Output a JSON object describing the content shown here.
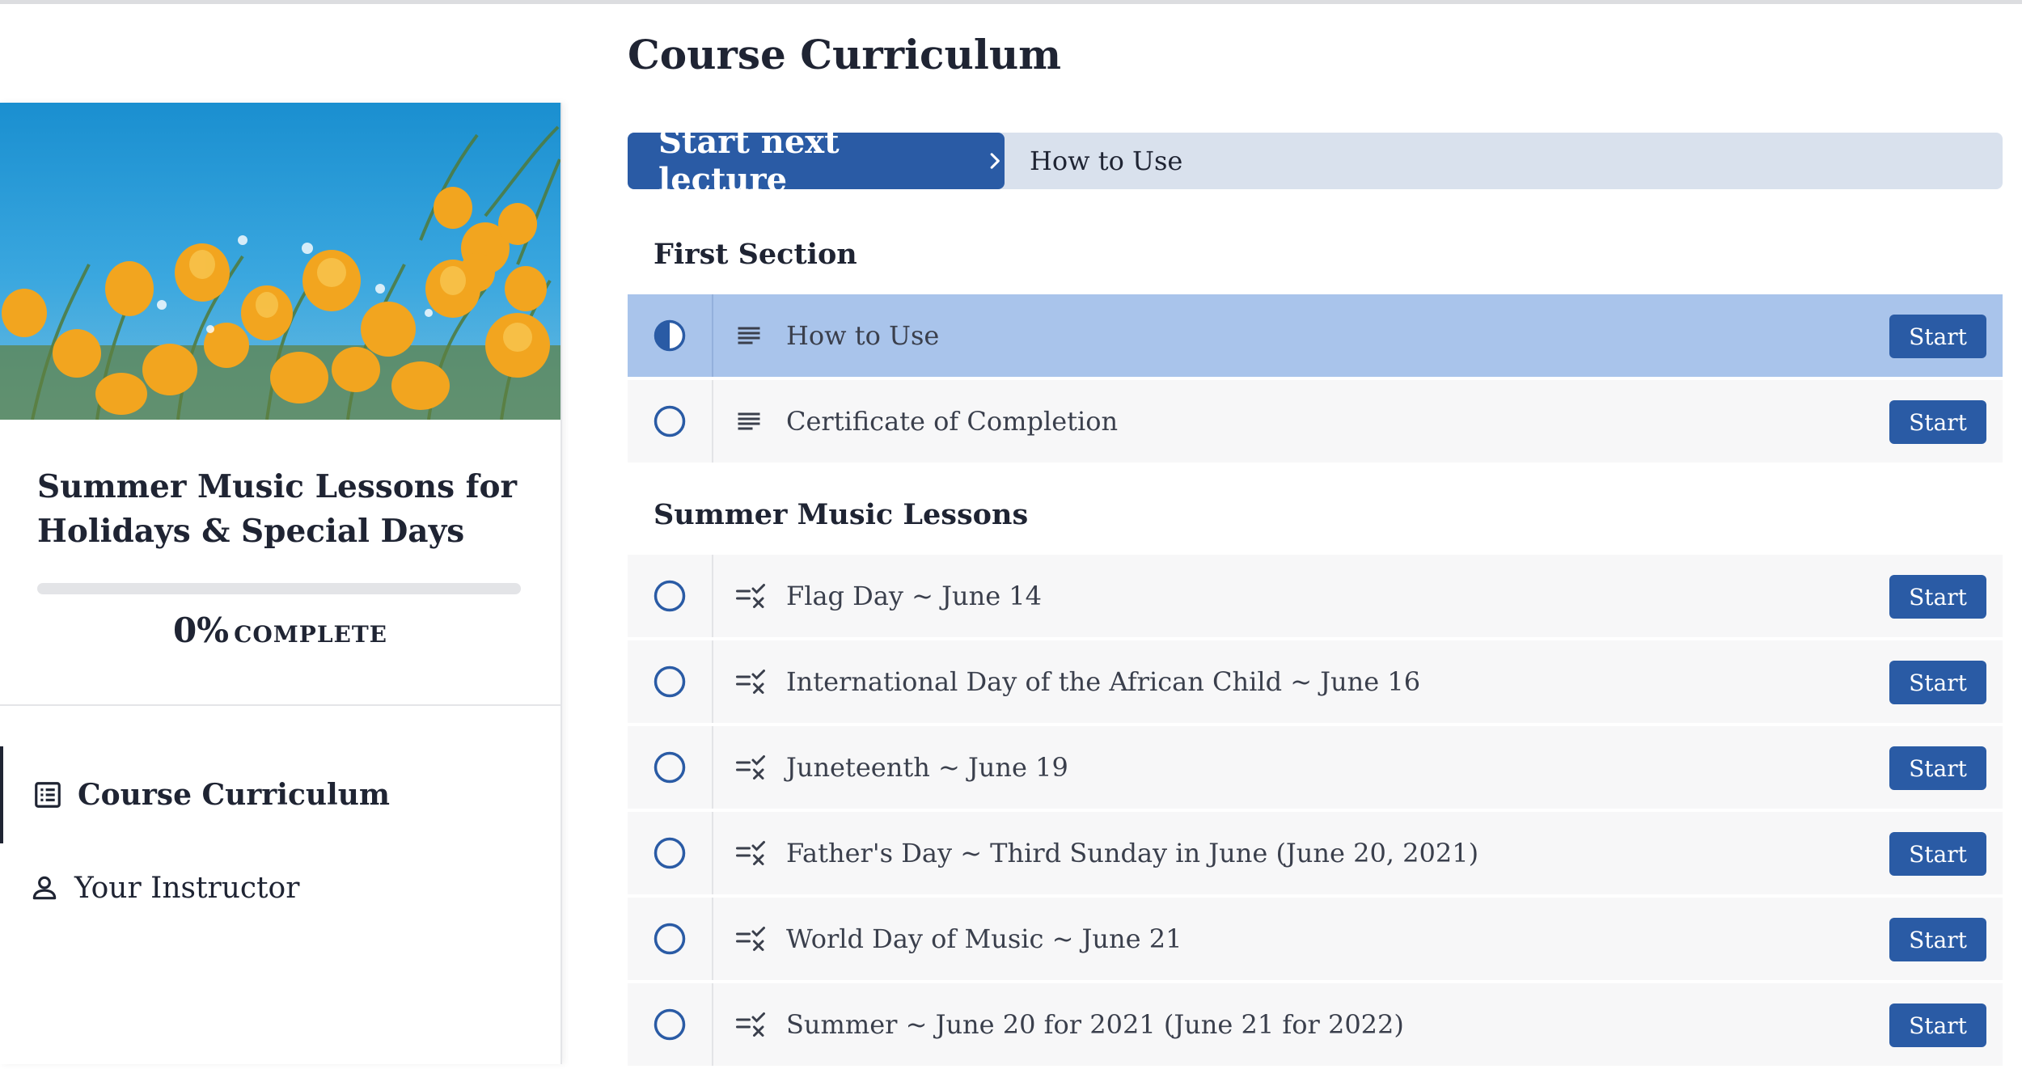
{
  "course": {
    "title": "Summer Music Lessons for Holidays & Special Days",
    "progress_percent": 0,
    "progress_text": "0%",
    "complete_label": "COMPLETE"
  },
  "nav": {
    "items": [
      {
        "label": "Course Curriculum",
        "icon": "list-alt-icon",
        "active": true
      },
      {
        "label": "Your Instructor",
        "icon": "person-icon",
        "active": false
      }
    ]
  },
  "main": {
    "title": "Course Curriculum",
    "next_button_label": "Start next lecture",
    "next_lecture_title": "How to Use"
  },
  "sections": [
    {
      "title": "First Section",
      "lectures": [
        {
          "title": "How to Use",
          "type_icon": "text-lines-icon",
          "status": "in-progress",
          "button": "Start",
          "current": true
        },
        {
          "title": "Certificate of Completion",
          "type_icon": "text-lines-icon",
          "status": "not-started",
          "button": "Start",
          "current": false
        }
      ]
    },
    {
      "title": "Summer Music Lessons",
      "lectures": [
        {
          "title": "Flag Day ~ June 14",
          "type_icon": "quiz-icon",
          "status": "not-started",
          "button": "Start",
          "current": false
        },
        {
          "title": "International Day of the African Child ~ June 16",
          "type_icon": "quiz-icon",
          "status": "not-started",
          "button": "Start",
          "current": false
        },
        {
          "title": "Juneteenth ~ June 19",
          "type_icon": "quiz-icon",
          "status": "not-started",
          "button": "Start",
          "current": false
        },
        {
          "title": "Father's Day ~ Third Sunday in June (June 20, 2021)",
          "type_icon": "quiz-icon",
          "status": "not-started",
          "button": "Start",
          "current": false
        },
        {
          "title": "World Day of Music ~ June 21",
          "type_icon": "quiz-icon",
          "status": "not-started",
          "button": "Start",
          "current": false
        },
        {
          "title": "Summer ~ June 20 for 2021 (June 21 for 2022)",
          "type_icon": "quiz-icon",
          "status": "not-started",
          "button": "Start",
          "current": false
        }
      ]
    }
  ],
  "colors": {
    "primary": "#2a5ba5",
    "current_row": "#a9c4eb",
    "next_bar": "#d9e1ed",
    "row_bg": "#f7f7f8",
    "text_dark": "#1f2433"
  }
}
